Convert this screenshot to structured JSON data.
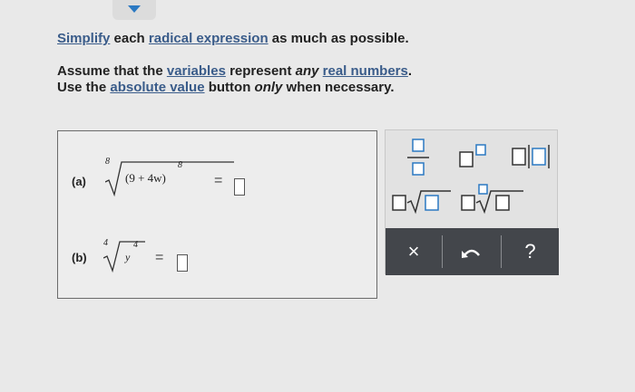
{
  "instructions": {
    "simplify_word": "Simplify",
    "each": " each ",
    "radical_expression": "radical expression",
    "rest1": " as much as possible.",
    "assume": "Assume that the ",
    "variables": "variables",
    "represent": " represent ",
    "any": "any",
    "space": " ",
    "real_numbers": "real numbers",
    "period": ".",
    "use_the": "Use the ",
    "absolute_value": "absolute value",
    "button": " button ",
    "only": "only",
    "when": " when necessary."
  },
  "part_a": {
    "label": "(a)",
    "index": "8",
    "base": "(9 + 4w)",
    "exponent": "8",
    "equals": "="
  },
  "part_b": {
    "label": "(b)",
    "index": "4",
    "radicand": "y",
    "exponent": "4",
    "equals": "="
  },
  "palette": {
    "buttons": [
      "fraction-icon",
      "exponent-icon",
      "absolute-value-icon",
      "square-root-icon",
      "nth-root-icon"
    ],
    "actions": {
      "clear_label": "×",
      "help_label": "?"
    }
  },
  "colors": {
    "link": "#3a5c8a",
    "icon_blue": "#2b79c2",
    "action_bar": "#43464b"
  }
}
